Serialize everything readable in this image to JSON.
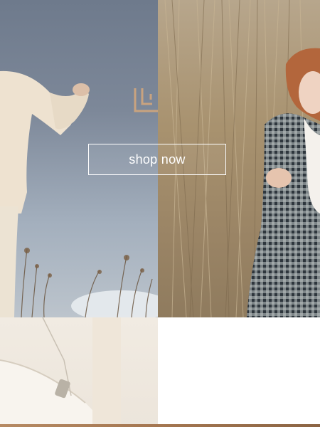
{
  "hero": {
    "cta_label": "shop now"
  },
  "colors": {
    "accent": "#c9a37f",
    "button_border": "#ffffff",
    "bottom_bar": "#a47650"
  }
}
